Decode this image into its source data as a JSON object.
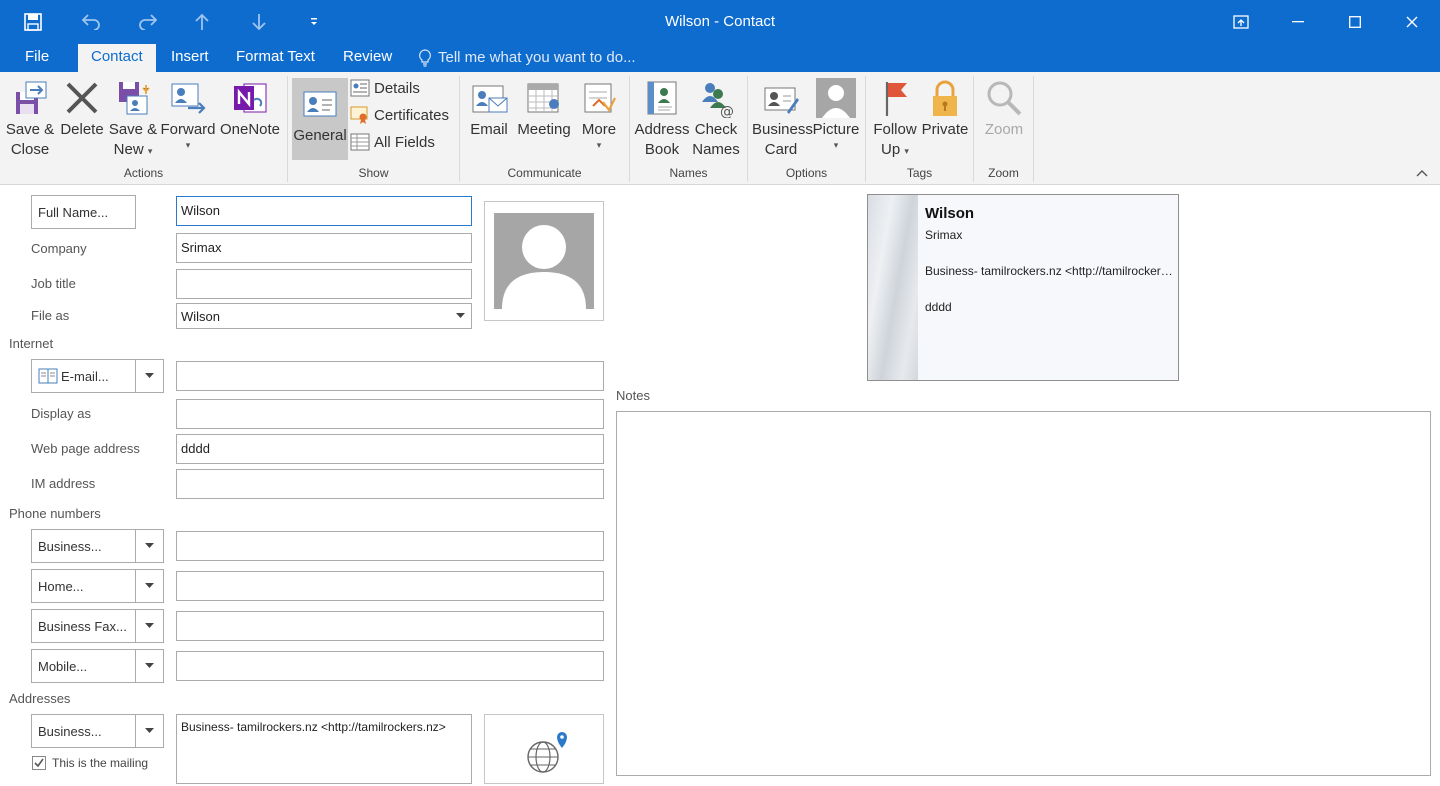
{
  "window": {
    "title": "Wilson - Contact",
    "accent": "#0f6ccf"
  },
  "quick_access": {
    "icons": [
      "save-icon",
      "undo-icon",
      "redo-icon",
      "up-icon",
      "down-icon",
      "customize-icon"
    ]
  },
  "tabs": [
    {
      "label": "File"
    },
    {
      "label": "Contact"
    },
    {
      "label": "Insert"
    },
    {
      "label": "Format Text"
    },
    {
      "label": "Review"
    }
  ],
  "tell_me": "Tell me what you want to do...",
  "ribbon": {
    "actions": {
      "label": "Actions",
      "save_close_1": "Save &",
      "save_close_2": "Close",
      "delete": "Delete",
      "save_new_1": "Save &",
      "save_new_2": "New",
      "forward": "Forward",
      "onenote": "OneNote"
    },
    "show": {
      "label": "Show",
      "general": "General",
      "details": "Details",
      "certificates": "Certificates",
      "all_fields": "All Fields"
    },
    "communicate": {
      "label": "Communicate",
      "email": "Email",
      "meeting": "Meeting",
      "more": "More"
    },
    "names": {
      "label": "Names",
      "address_book_1": "Address",
      "address_book_2": "Book",
      "check_names_1": "Check",
      "check_names_2": "Names"
    },
    "options": {
      "label": "Options",
      "business_card_1": "Business",
      "business_card_2": "Card",
      "picture": "Picture"
    },
    "tags": {
      "label": "Tags",
      "follow_up_1": "Follow",
      "follow_up_2": "Up",
      "private": "Private"
    },
    "zoom": {
      "label": "Zoom",
      "zoom": "Zoom"
    }
  },
  "form": {
    "full_name_button": "Full Name...",
    "full_name_value": "Wilson",
    "company_label": "Company",
    "company_value": "Srimax",
    "job_title_label": "Job title",
    "job_title_value": "",
    "file_as_label": "File as",
    "file_as_value": "Wilson",
    "internet_section": "Internet",
    "email_button": "E-mail...",
    "email_value": "",
    "display_as_label": "Display as",
    "display_as_value": "",
    "web_page_label": "Web page address",
    "web_page_value": "dddd",
    "im_label": "IM address",
    "im_value": "",
    "phone_section": "Phone numbers",
    "phones": [
      {
        "label": "Business...",
        "value": ""
      },
      {
        "label": "Home...",
        "value": ""
      },
      {
        "label": "Business Fax...",
        "value": ""
      },
      {
        "label": "Mobile...",
        "value": ""
      }
    ],
    "addresses_section": "Addresses",
    "address_button": "Business...",
    "address_value": "Business-  tamilrockers.nz <http://tamilrockers.nz>",
    "mailing_checkbox": "This is the mailing",
    "mailing_checked": true,
    "notes_label": "Notes",
    "notes_value": ""
  },
  "business_card": {
    "name": "Wilson",
    "company": "Srimax",
    "address": "Business-  tamilrockers.nz <http://tamilrockers.nz>",
    "web": "dddd"
  }
}
